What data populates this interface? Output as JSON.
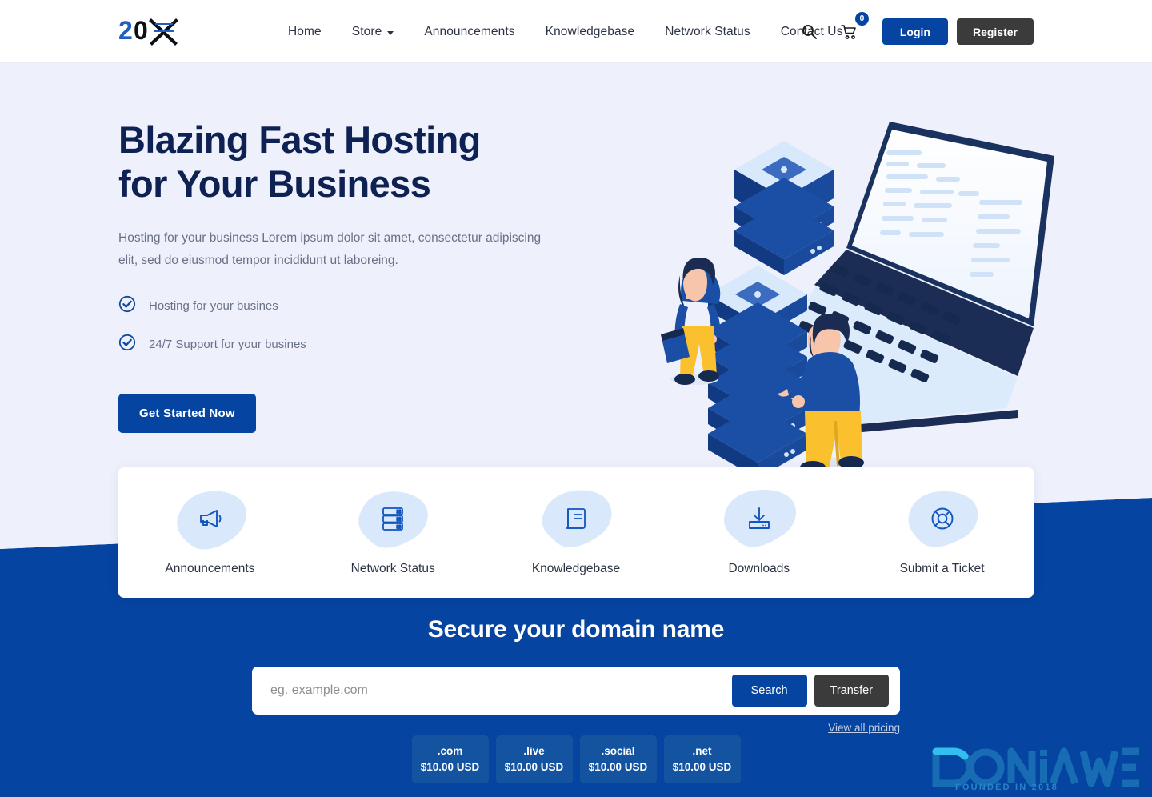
{
  "header": {
    "logo": {
      "text_blue": "20",
      "text_dark": "0",
      "mark": "X",
      "alt": "20X"
    },
    "nav": [
      {
        "label": "Home",
        "has_caret": false
      },
      {
        "label": "Store",
        "has_caret": true
      },
      {
        "label": "Announcements",
        "has_caret": false
      },
      {
        "label": "Knowledgebase",
        "has_caret": false
      },
      {
        "label": "Network Status",
        "has_caret": false
      },
      {
        "label": "Contact Us",
        "has_caret": false
      }
    ],
    "search_icon": "search-icon",
    "cart_icon": "shopping-cart-icon",
    "cart_count": "0",
    "login_label": "Login",
    "register_label": "Register"
  },
  "hero": {
    "title_line1": "Blazing Fast Hosting",
    "title_line2": "for Your Business",
    "subtitle": "Hosting for your business Lorem ipsum dolor sit amet, consectetur adipiscing elit, sed do eiusmod tempor incididunt ut laboreing.",
    "features": [
      {
        "icon": "check-circle-icon",
        "label": "Hosting for your busines"
      },
      {
        "icon": "check-circle-icon",
        "label": "24/7 Support for your busines"
      }
    ],
    "cta_label": "Get Started Now",
    "illustration": "isometric-server-laptop-illustration"
  },
  "services": [
    {
      "icon": "megaphone-icon",
      "label": "Announcements"
    },
    {
      "icon": "server-rack-icon",
      "label": "Network Status"
    },
    {
      "icon": "book-icon",
      "label": "Knowledgebase"
    },
    {
      "icon": "download-tray-icon",
      "label": "Downloads"
    },
    {
      "icon": "lifebuoy-icon",
      "label": "Submit a Ticket"
    }
  ],
  "domain": {
    "title": "Secure your domain name",
    "input_placeholder": "eg. example.com",
    "input_value": "",
    "search_label": "Search",
    "transfer_label": "Transfer",
    "view_all_pricing": "View all pricing",
    "tlds": [
      {
        "name": ".com",
        "price": "$10.00 USD"
      },
      {
        "name": ".live",
        "price": "$10.00 USD"
      },
      {
        "name": ".social",
        "price": "$10.00 USD"
      },
      {
        "name": ".net",
        "price": "$10.00 USD"
      }
    ]
  },
  "watermark": {
    "title": "DONiA WEB",
    "subtitle": "FOUNDED IN 2018"
  },
  "colors": {
    "primary_blue": "#0544a0",
    "dark_button": "#3b3b3b",
    "hero_bg": "#eef0fc",
    "heading_navy": "#0d2252",
    "body_text": "#6a7186",
    "icon_blob": "#d9e8fb"
  }
}
